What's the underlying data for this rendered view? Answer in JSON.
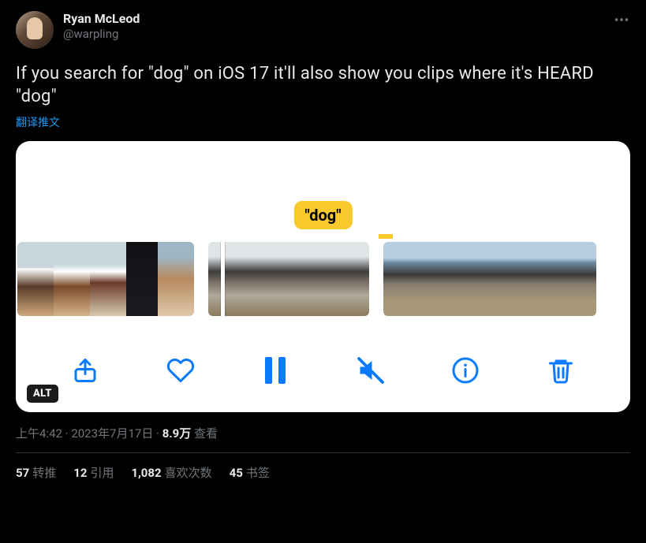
{
  "author": {
    "display_name": "Ryan McLeod",
    "handle": "@warpling"
  },
  "body_text": "If you search for \"dog\" on iOS 17 it'll also show you clips where it's HEARD \"dog\"",
  "translate_label": "翻译推文",
  "media": {
    "caption_highlight": "\"dog\"",
    "alt_badge": "ALT"
  },
  "meta": {
    "time": "上午4:42",
    "date": "2023年7月17日",
    "views_count": "8.9万",
    "views_label": "查看",
    "separator": " · "
  },
  "stats": {
    "retweets": {
      "count": "57",
      "label": "转推"
    },
    "quotes": {
      "count": "12",
      "label": "引用"
    },
    "likes": {
      "count": "1,082",
      "label": "喜欢次数"
    },
    "bookmarks": {
      "count": "45",
      "label": "书签"
    }
  }
}
